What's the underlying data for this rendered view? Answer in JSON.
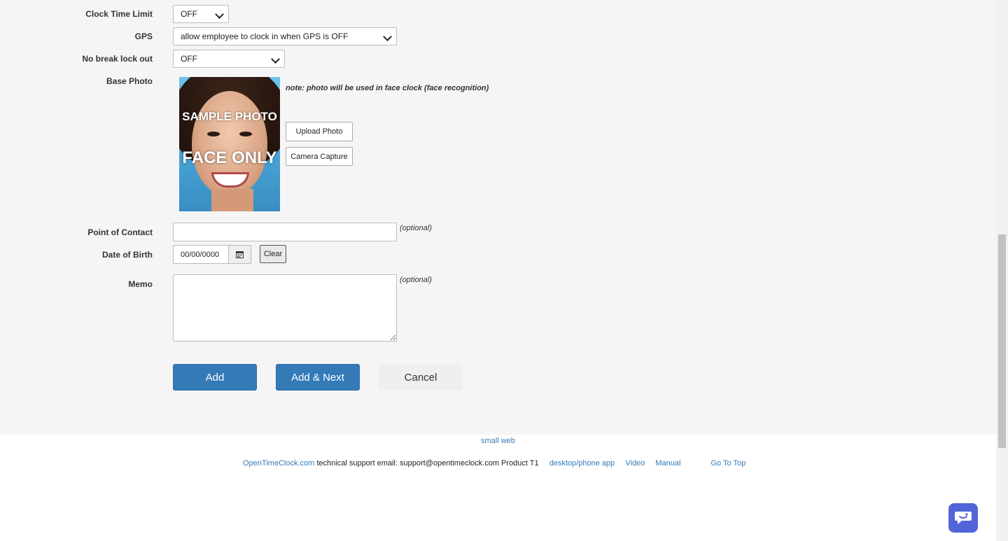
{
  "form": {
    "clock_time_limit": {
      "label": "Clock Time Limit",
      "value": "OFF"
    },
    "gps": {
      "label": "GPS",
      "value": "allow employee to clock in when GPS is OFF"
    },
    "no_break_lock_out": {
      "label": "No break lock out",
      "value": "OFF"
    },
    "base_photo": {
      "label": "Base Photo",
      "sample_line1": "SAMPLE PHOTO",
      "sample_line2": "FACE ONLY",
      "note": "note: photo will be used in face clock (face recognition)",
      "upload_label": "Upload Photo",
      "camera_label": "Camera Capture"
    },
    "point_of_contact": {
      "label": "Point of Contact",
      "value": "",
      "hint": "(optional)"
    },
    "date_of_birth": {
      "label": "Date of Birth",
      "value": "00/00/0000",
      "clear_label": "Clear"
    },
    "memo": {
      "label": "Memo",
      "value": "",
      "hint": "(optional)"
    }
  },
  "actions": {
    "add": "Add",
    "add_next": "Add & Next",
    "cancel": "Cancel"
  },
  "footer": {
    "small_web": "small web",
    "brand_link": "OpenTimeClock.com",
    "support_text": "technical support email: support@opentimeclock.com Product T1",
    "links": {
      "app": "desktop/phone app",
      "video": "Video",
      "manual": "Manual",
      "top": "Go To Top"
    }
  },
  "icons": {
    "calendar": "calendar-icon",
    "chat": "chat-bubble-icon",
    "chevron": "chevron-down-icon"
  },
  "colors": {
    "primary": "#337ab7",
    "chat": "#5165d8",
    "background": "#f5f5f5"
  }
}
